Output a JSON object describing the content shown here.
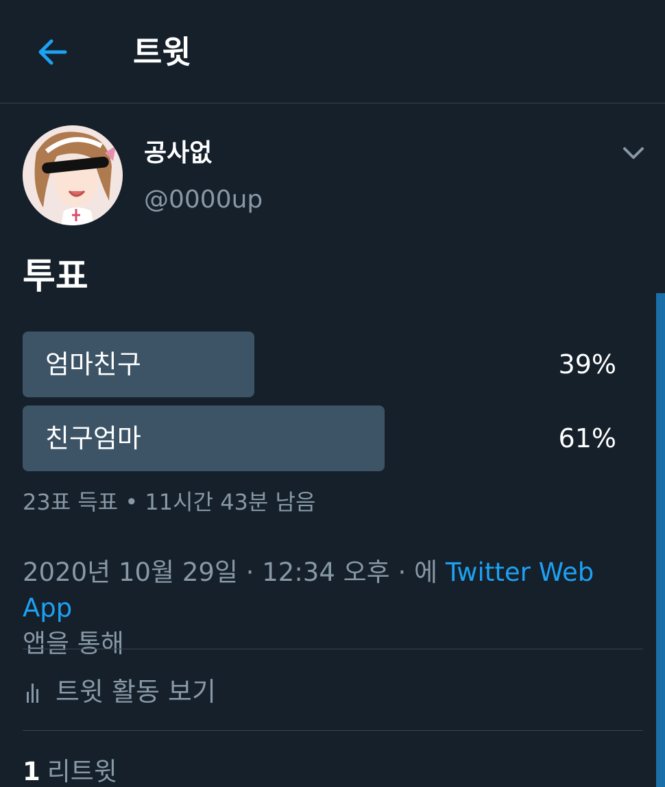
{
  "header": {
    "title": "트윗",
    "back_icon": "arrow-left-icon",
    "accent_color": "#1da1f2"
  },
  "tweet": {
    "display_name": "공사없",
    "handle": "@0000up",
    "more_icon": "chevron-down-icon",
    "text": "투표",
    "poll": {
      "options": [
        {
          "label": "엄마친구",
          "percent_text": "39%",
          "percent": 39
        },
        {
          "label": "친구엄마",
          "percent_text": "61%",
          "percent": 61
        }
      ],
      "meta": "23표 득표 • 11시간 43분 남음"
    },
    "timestamp_prefix": "2020년 10월 29일 · 12:34 오후 · 에 ",
    "source": "Twitter Web App",
    "timestamp_suffix": "앱을 통해",
    "activity_label": "트윗 활동 보기",
    "activity_icon": "bar-chart-icon",
    "retweet_count": "1",
    "retweet_label": "리트윗"
  },
  "colors": {
    "background": "#15202b",
    "poll_bar": "#3d5466",
    "muted_text": "#8899a6",
    "link": "#1da1f2"
  }
}
